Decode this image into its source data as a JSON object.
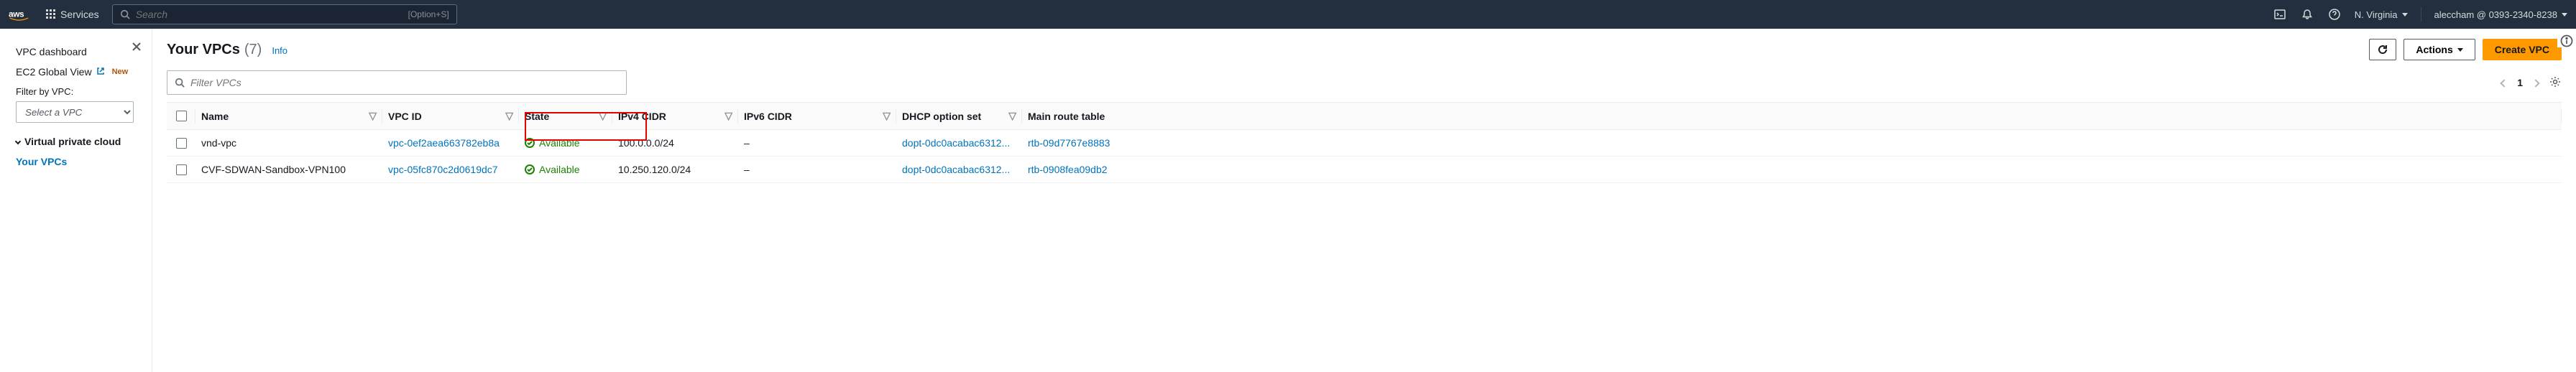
{
  "topnav": {
    "services_label": "Services",
    "search_placeholder": "Search",
    "search_hint": "[Option+S]",
    "region": "N. Virginia",
    "account": "aleccham @ 0393-2340-8238"
  },
  "sidebar": {
    "dashboard": "VPC dashboard",
    "ec2_global": "EC2 Global View",
    "new_badge": "New",
    "filter_label": "Filter by VPC:",
    "select_placeholder": "Select a VPC",
    "section_vpc": "Virtual private cloud",
    "your_vpcs": "Your VPCs"
  },
  "header": {
    "title": "Your VPCs",
    "count": "(7)",
    "info": "Info",
    "actions_label": "Actions",
    "create_label": "Create VPC"
  },
  "filter": {
    "placeholder": "Filter VPCs"
  },
  "pagination": {
    "page": "1"
  },
  "columns": {
    "name": "Name",
    "vpc_id": "VPC ID",
    "state": "State",
    "ipv4": "IPv4 CIDR",
    "ipv6": "IPv6 CIDR",
    "dhcp": "DHCP option set",
    "route": "Main route table"
  },
  "rows": [
    {
      "name": "vnd-vpc",
      "vpc_id": "vpc-0ef2aea663782eb8a",
      "state": "Available",
      "ipv4": "100.0.0.0/24",
      "ipv6": "–",
      "dhcp": "dopt-0dc0acabac6312...",
      "route": "rtb-09d7767e8883"
    },
    {
      "name": "CVF-SDWAN-Sandbox-VPN100",
      "vpc_id": "vpc-05fc870c2d0619dc7",
      "state": "Available",
      "ipv4": "10.250.120.0/24",
      "ipv6": "–",
      "dhcp": "dopt-0dc0acabac6312...",
      "route": "rtb-0908fea09db2"
    }
  ]
}
